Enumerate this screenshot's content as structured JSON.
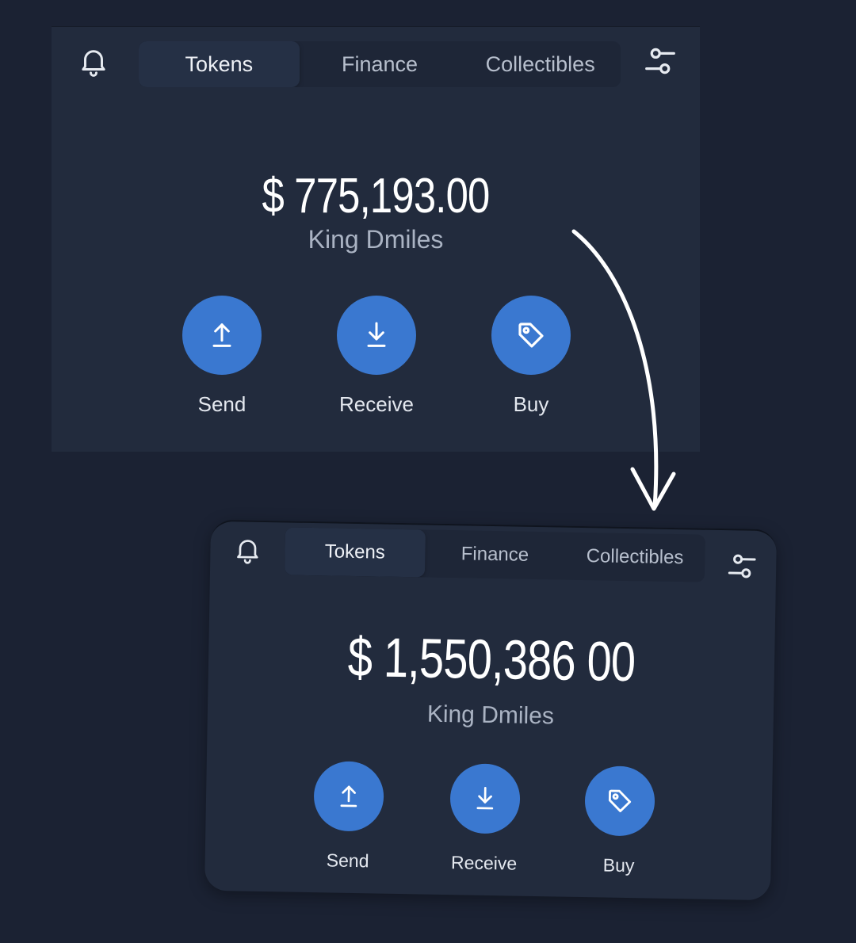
{
  "top_card": {
    "tabs": [
      "Tokens",
      "Finance",
      "Collectibles"
    ],
    "active_tab": "Tokens",
    "balance": "$ 775,193.00",
    "owner": "King Dmiles",
    "actions": {
      "send": "Send",
      "receive": "Receive",
      "buy": "Buy"
    }
  },
  "bottom_card": {
    "tabs": [
      "Tokens",
      "Finance",
      "Collectibles"
    ],
    "active_tab": "Tokens",
    "balance": "$ 1,550,386 00",
    "owner": "King Dmiles",
    "actions": {
      "send": "Send",
      "receive": "Receive",
      "buy": "Buy"
    }
  },
  "icons": {
    "bell": "bell-icon",
    "settings": "sliders-icon",
    "send": "arrow-up-icon",
    "receive": "arrow-down-icon",
    "buy": "tag-icon",
    "transition": "curved-arrow-icon"
  },
  "colors": {
    "background": "#1b2233",
    "card": "#222b3d",
    "accent": "#3a78d0",
    "text": "#ffffff"
  }
}
